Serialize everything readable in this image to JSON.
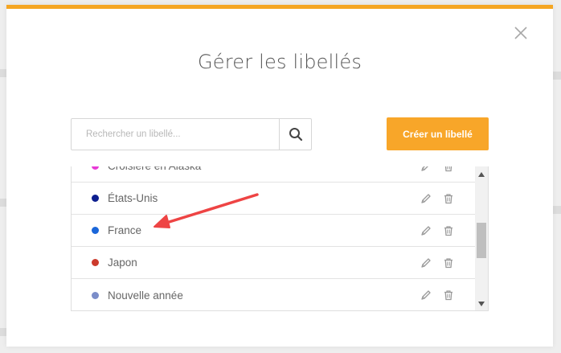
{
  "modal": {
    "title": "Gérer les libellés",
    "accent_color": "#f5a623"
  },
  "search": {
    "placeholder": "Rechercher un libellé...",
    "value": ""
  },
  "create_button": {
    "label": "Créer un libellé",
    "color": "#f8a629"
  },
  "labels": [
    {
      "name": "Croisière en Alaska",
      "color": "#e83ad6",
      "icons": [
        "pencil-icon",
        "trash-icon"
      ]
    },
    {
      "name": "États-Unis",
      "color": "#0d1f8f",
      "icons": [
        "pencil-icon",
        "trash-icon"
      ]
    },
    {
      "name": "France",
      "color": "#1a66d9",
      "icons": [
        "pencil-icon",
        "trash-icon"
      ]
    },
    {
      "name": "Japon",
      "color": "#cc3a2c",
      "icons": [
        "pencil-icon",
        "trash-icon"
      ]
    },
    {
      "name": "Nouvelle année",
      "color": "#7b8dc9",
      "icons": [
        "pencil-icon",
        "trash-icon"
      ]
    }
  ],
  "annotation": {
    "arrow_color": "#ee4444",
    "points_to": "France"
  }
}
